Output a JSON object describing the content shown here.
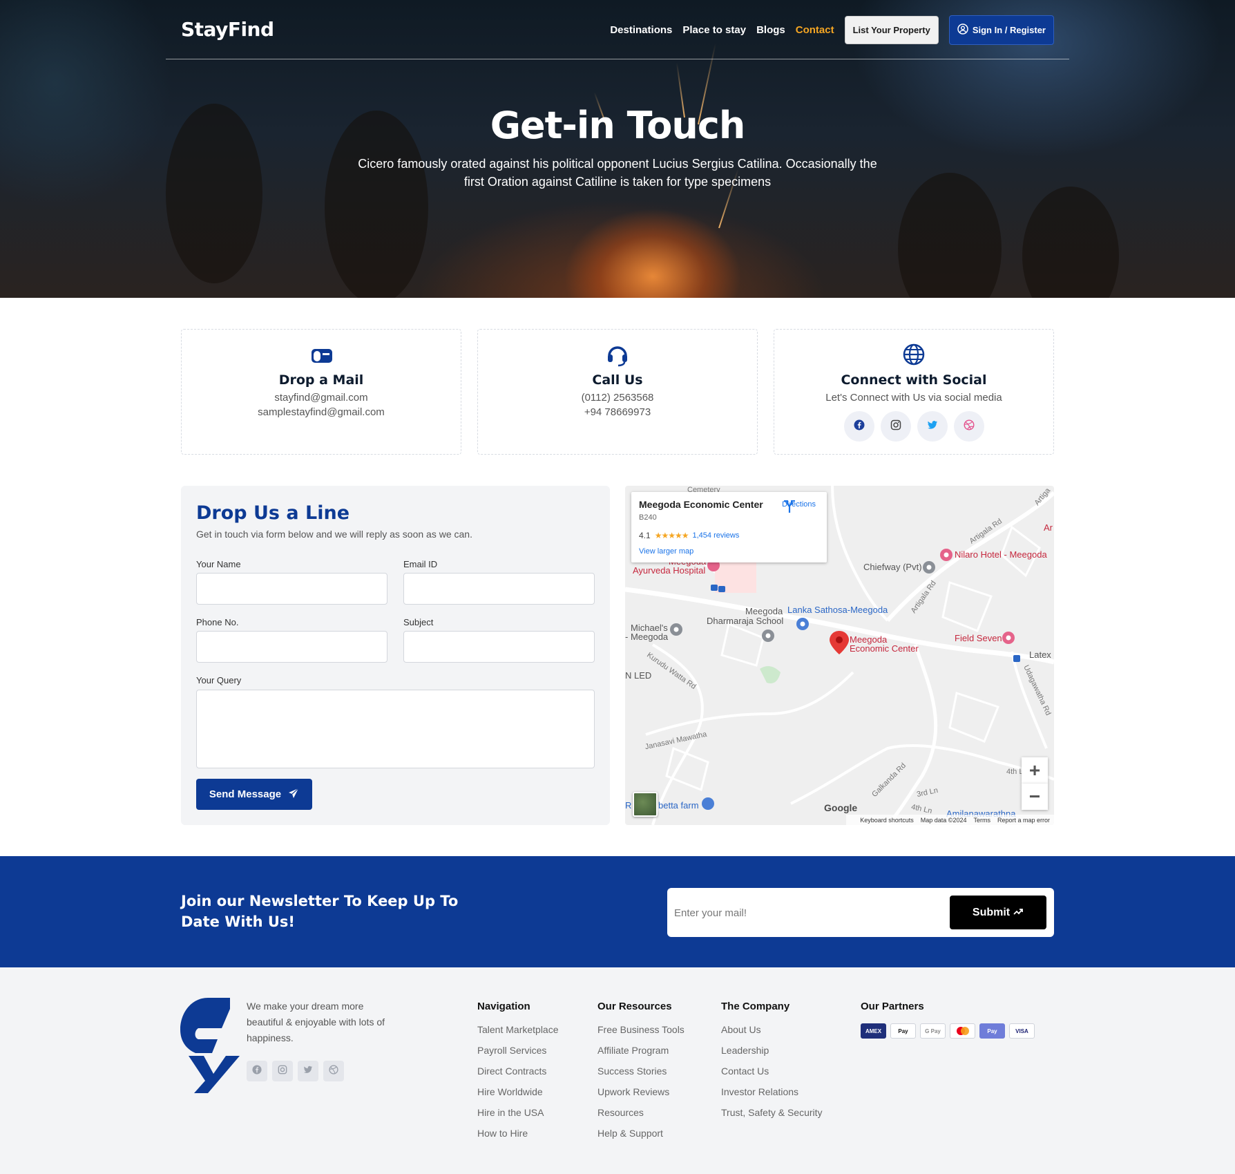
{
  "brand": {
    "name": "StayFind",
    "primary_color": "#0d3a94",
    "accent_color": "#f5a623"
  },
  "nav": {
    "links": [
      "Destinations",
      "Place to stay",
      "Blogs",
      "Contact"
    ],
    "active": "Contact",
    "list_property": "List Your Property",
    "sign_in": "Sign In / Register"
  },
  "hero": {
    "title": "Get-in Touch",
    "subtitle": "Cicero famously orated against his political opponent Lucius Sergius Catilina. Occasionally the first Oration against Catiline is taken for type specimens"
  },
  "cards": {
    "mail": {
      "icon": "mailbox-icon",
      "title": "Drop a Mail",
      "lines": [
        "stayfind@gmail.com",
        "samplestayfind@gmail.com"
      ]
    },
    "call": {
      "icon": "headset-icon",
      "title": "Call Us",
      "lines": [
        "(0112) 2563568",
        "+94 78669973"
      ]
    },
    "social": {
      "icon": "globe-icon",
      "title": "Connect with Social",
      "text": "Let's Connect with Us via social media",
      "networks": [
        {
          "icon": "facebook-icon",
          "color": "#1d3f9b"
        },
        {
          "icon": "instagram-icon",
          "color": "#444444"
        },
        {
          "icon": "twitter-icon",
          "color": "#1da1f2"
        },
        {
          "icon": "dribbble-icon",
          "color": "#e4508c"
        }
      ]
    }
  },
  "form": {
    "title": "Drop Us a Line",
    "description": "Get in touch via form below and we will reply as soon as we can.",
    "name_label": "Your Name",
    "email_label": "Email ID",
    "phone_label": "Phone No.",
    "subject_label": "Subject",
    "query_label": "Your Query",
    "name_value": "",
    "email_value": "",
    "phone_value": "",
    "subject_value": "",
    "query_value": "",
    "submit": "Send Message"
  },
  "map": {
    "place": "Meegoda Economic Center",
    "code": "B240",
    "rating": "4.1",
    "stars": "★★★★★",
    "reviews": "1,454 reviews",
    "view_larger": "View larger map",
    "directions": "Directions",
    "labels": {
      "nilaro": "Nilaro Hotel - Meegoda",
      "chiefway": "Chiefway (Pvt)",
      "lanka": "Lanka Sathosa-Meegoda",
      "school_1": "Meegoda",
      "school_2": "Dharmaraja School",
      "michaels_1": "Michael's",
      "michaels_2": "- Meegoda",
      "center_1": "Meegoda",
      "center_2": "Economic Center",
      "field": "Field Seven",
      "latex": "Latex",
      "led": "N LED",
      "hospital_1": "Meegoda",
      "hospital_2": "Ayurveda Hospital",
      "betta": "betta farm",
      "amila": "Amilanawarathna",
      "cemetery": "Cemetery",
      "r": "R",
      "a": "Ar",
      "artigala_rd": "Artigala Rd",
      "artigala_rd_2": "Artigala Rd",
      "artiga": "Artiga",
      "kurudu": "Kurudu Watta Rd",
      "janasavi": "Janasavi Mawatha",
      "galkanda": "Galkanda Rd",
      "udagawatha": "Udagawatha Rd",
      "third": "3rd Ln",
      "fourth": "4th Ln",
      "fourth2": "4th L"
    },
    "zoom_in": "+",
    "zoom_out": "−",
    "google": "Google",
    "footer": [
      "Keyboard shortcuts",
      "Map data ©2024",
      "Terms",
      "Report a map error"
    ]
  },
  "newsletter": {
    "title": "Join our Newsletter To Keep Up To Date With Us!",
    "placeholder": "Enter your mail!",
    "submit": "Submit"
  },
  "footer": {
    "description": "We make your dream more beautiful & enjoyable with lots of happiness.",
    "navigation": {
      "title": "Navigation",
      "items": [
        "Talent Marketplace",
        "Payroll Services",
        "Direct Contracts",
        "Hire Worldwide",
        "Hire in the USA",
        "How to Hire"
      ]
    },
    "resources": {
      "title": "Our Resources",
      "items": [
        "Free Business Tools",
        "Affiliate Program",
        "Success Stories",
        "Upwork Reviews",
        "Resources",
        "Help & Support"
      ]
    },
    "company": {
      "title": "The Company",
      "items": [
        "About Us",
        "Leadership",
        "Contact Us",
        "Investor Relations",
        "Trust, Safety & Security"
      ]
    },
    "partners": {
      "title": "Our Partners",
      "items": [
        "AMEX",
        "Pay",
        "G Pay",
        "",
        "Pay",
        "VISA"
      ]
    }
  }
}
